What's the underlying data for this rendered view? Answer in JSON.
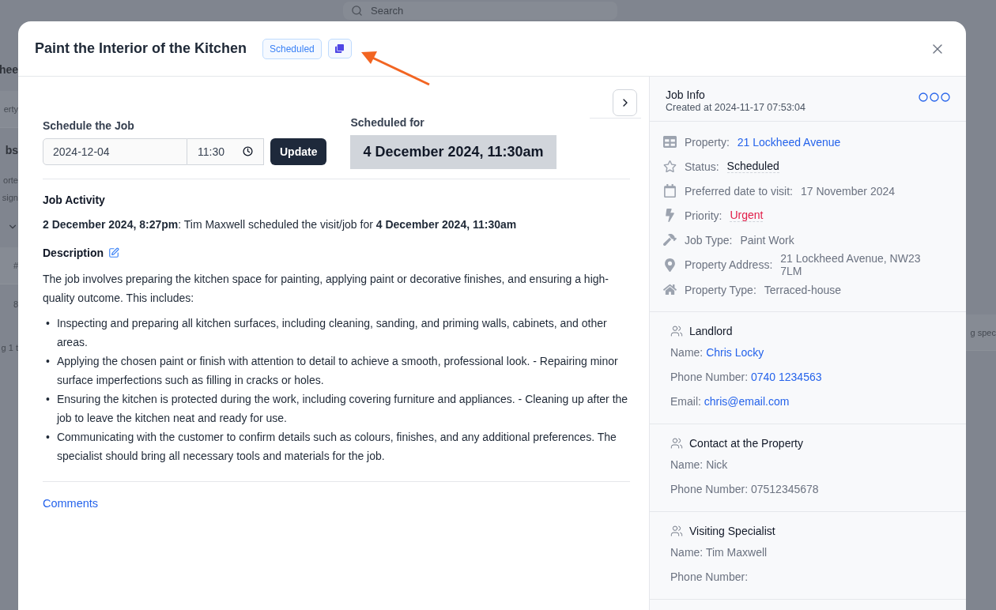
{
  "background_page": {
    "search_placeholder": "Search",
    "left_fragments": [
      {
        "kind": "heading",
        "text": "hee"
      },
      {
        "kind": "header",
        "text": "erty"
      },
      {
        "kind": "heading",
        "text": "bs"
      },
      {
        "kind": "text",
        "text": "orte"
      },
      {
        "kind": "text",
        "text": "sign"
      },
      {
        "kind": "select"
      },
      {
        "kind": "header",
        "text": "#"
      },
      {
        "kind": "cell",
        "text": "8"
      },
      {
        "kind": "footer",
        "text": "g 1 t"
      }
    ],
    "right_fragment": "g spec"
  },
  "modal": {
    "title": "Paint the Interior of the Kitchen",
    "status_badge": "Scheduled"
  },
  "schedule": {
    "label": "Schedule the Job",
    "date": "2024-12-04",
    "time": "11:30",
    "button": "Update",
    "scheduled_for_label": "Scheduled for",
    "scheduled_for": "4 December 2024, 11:30am"
  },
  "activity": {
    "title": "Job Activity",
    "entries": [
      "**2 December 2024, 8:27pm**: Tim Maxwell scheduled the visit/job for **4 December 2024, 11:30am**"
    ]
  },
  "description": {
    "title": "Description",
    "bullet": "•",
    "intro": "The job involves preparing the kitchen space for painting, applying paint or decorative finishes, and ensuring a high-quality outcome. This includes:",
    "items": [
      "Inspecting and preparing all kitchen surfaces, including cleaning, sanding, and priming walls, cabinets, and other areas.",
      "Applying the chosen paint or finish with attention to detail to achieve a smooth, professional look. - Repairing minor surface imperfections such as filling in cracks or holes.",
      "Ensuring the kitchen is protected during the work, including covering furniture and appliances. - Cleaning up after the job to leave the kitchen neat and ready for use.",
      "Communicating with the customer to confirm details such as colours, finishes, and any additional preferences. The specialist should bring all necessary tools and materials for the job."
    ]
  },
  "comments_link": "Comments",
  "job_info": {
    "title": "Job Info",
    "created": "Created at 2024-11-17 07:53:04",
    "rows": [
      {
        "kind": "property",
        "label": "Property:",
        "value": "21 Lockheed Avenue",
        "link": true
      },
      {
        "kind": "status",
        "label": "Status:",
        "value": "Scheduled",
        "link": false,
        "underlined": true,
        "color": "#111827"
      },
      {
        "kind": "preferred_date",
        "label": "Preferred date to visit:",
        "value": "17 November 2024",
        "link": false
      },
      {
        "kind": "priority",
        "label": "Priority:",
        "value": "Urgent",
        "link": false,
        "underlined": true,
        "color": "#e11d48"
      },
      {
        "kind": "job_type",
        "label": "Job Type:",
        "value": "Paint Work",
        "link": false
      },
      {
        "kind": "address",
        "label": "Property Address:",
        "value": "21 Lockheed Avenue, NW23 7LM",
        "link": false
      },
      {
        "kind": "property_type",
        "label": "Property Type:",
        "value": "Terraced-house",
        "link": false
      }
    ]
  },
  "contacts": [
    {
      "title": "Landlord",
      "fields": [
        {
          "label": "Name:",
          "value": "Chris Locky",
          "link": true
        },
        {
          "label": "Phone Number:",
          "value": "0740 1234563",
          "link": true
        },
        {
          "label": "Email:",
          "value": "chris@email.com",
          "link": true
        }
      ]
    },
    {
      "title": "Contact at the Property",
      "fields": [
        {
          "label": "Name:",
          "value": "Nick",
          "link": false
        },
        {
          "label": "Phone Number:",
          "value": "07512345678",
          "link": false
        }
      ]
    },
    {
      "title": "Visiting Specialist",
      "fields": [
        {
          "label": "Name:",
          "value": "Tim Maxwell",
          "link": false
        },
        {
          "label": "Phone Number:"
        }
      ]
    }
  ]
}
